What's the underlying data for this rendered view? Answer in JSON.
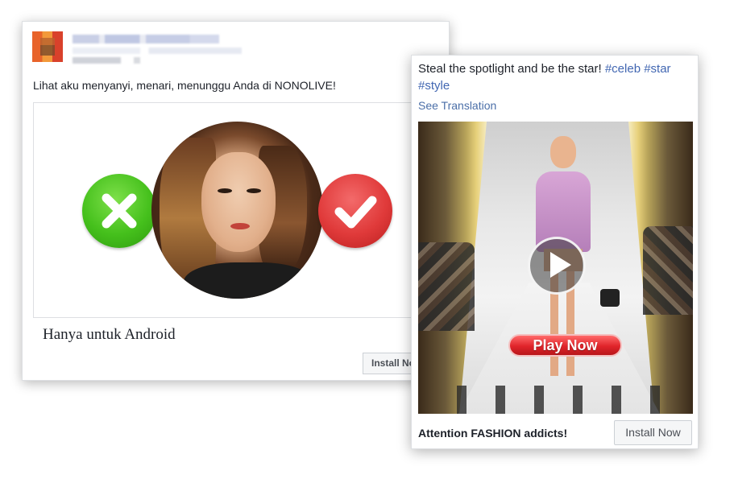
{
  "ad_left": {
    "post_text": "Lihat aku menyanyi, menari, menunggu Anda di NONOLIVE!",
    "headline": "Hanya untuk Android",
    "install_label": "Install Now",
    "reject_symbol": "✕",
    "accept_symbol": "✔"
  },
  "ad_right": {
    "post_text_main": "Steal the spotlight and be the star!",
    "hashtags": [
      "#celeb",
      "#star",
      "#style"
    ],
    "see_translation": "See Translation",
    "video_cta": "Play Now",
    "headline": "Attention FASHION addicts!",
    "install_label": "Install Now"
  },
  "colors": {
    "hashtag": "#4267b2",
    "reject_green": "#45c01c",
    "accept_red": "#e03a3a",
    "play_now_red": "#e0242a"
  }
}
